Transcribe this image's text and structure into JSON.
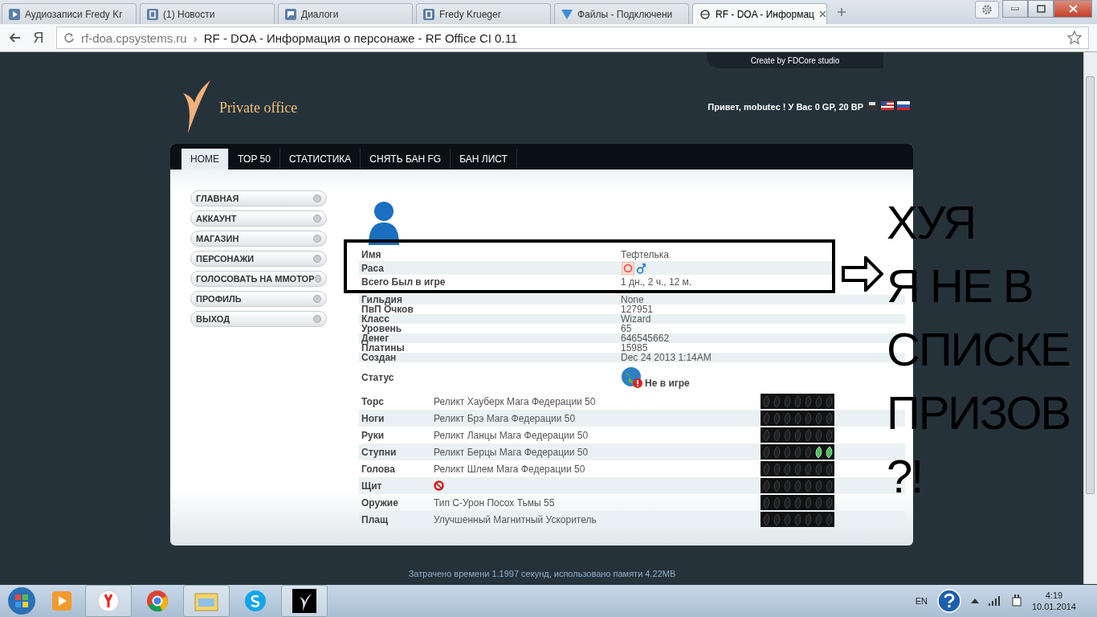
{
  "browser": {
    "tabs": [
      {
        "title": "Аудиозаписи Fredy Kr",
        "selected": false
      },
      {
        "title": "(1) Новости",
        "selected": false
      },
      {
        "title": "Диалоги",
        "selected": false
      },
      {
        "title": "Fredy Krueger",
        "selected": false
      },
      {
        "title": "Файлы - Подключени",
        "selected": false
      },
      {
        "title": "RF - DOA - Информац",
        "selected": true
      }
    ],
    "logo_key": "Я",
    "address": {
      "host": "rf-doa.cpsystems.ru",
      "separator": "›",
      "title": "RF - DOA - Информация о персонаже - RF Office CI 0.11"
    }
  },
  "page": {
    "credit": "Create by FDCore studio",
    "logo_text": "Private office",
    "greeting": "Привет, mobutec ! У Вас 0 GP, 20 BP",
    "nav": [
      {
        "label": "HOME",
        "selected": true
      },
      {
        "label": "TOP 50",
        "selected": false
      },
      {
        "label": "СТАТИСТИКА",
        "selected": false
      },
      {
        "label": "СНЯТЬ БАН FG",
        "selected": false
      },
      {
        "label": "БАН ЛИСТ",
        "selected": false
      }
    ],
    "menu": [
      "ГЛАВНАЯ",
      "АККАУНТ",
      "МАГАЗИН",
      "ПЕРСОНАЖИ",
      "ГОЛОСОВАТЬ НА ММОТОР",
      "ПРОФИЛЬ",
      "ВЫХОД"
    ],
    "info": [
      {
        "label": "Имя",
        "value": "Тефтелька",
        "highlighted": true
      },
      {
        "label": "Раса",
        "kind": "race",
        "highlighted": true
      },
      {
        "label": "Всего Был в игре",
        "value": "1 дн., 2 ч., 12 м.",
        "highlighted": true
      },
      {
        "label": "Гильдия",
        "value": "None",
        "highlighted": false
      },
      {
        "label": "ПвП Очков",
        "value": "127951",
        "highlighted": false
      },
      {
        "label": "Класс",
        "value": "Wizard",
        "highlighted": false
      },
      {
        "label": "Уровень",
        "value": "65",
        "highlighted": false
      },
      {
        "label": "Денег",
        "value": "646545662",
        "highlighted": false
      },
      {
        "label": "Платины",
        "value": "15985",
        "highlighted": false
      },
      {
        "label": "Создан",
        "value": "Dec 24 2013 1:14AM",
        "highlighted": false
      },
      {
        "label": "Статус",
        "kind": "status",
        "value": "Не в игре"
      }
    ],
    "equipment": [
      {
        "slot": "Торс",
        "item": "Реликт Хауберк Мага Федерации 50",
        "upgrade_slots": [
          false,
          false,
          false,
          false,
          false,
          false,
          false
        ]
      },
      {
        "slot": "Ноги",
        "item": "Реликт Брэ Мага Федерации 50",
        "upgrade_slots": [
          false,
          false,
          false,
          false,
          false,
          false,
          false
        ]
      },
      {
        "slot": "Руки",
        "item": "Реликт Ланцы Мага Федерации 50",
        "upgrade_slots": [
          false,
          false,
          false,
          false,
          false,
          false,
          false
        ]
      },
      {
        "slot": "Ступни",
        "item": "Реликт Берцы Мага Федерации 50",
        "upgrade_slots": [
          false,
          false,
          false,
          false,
          false,
          true,
          true
        ]
      },
      {
        "slot": "Голова",
        "item": "Реликт Шлем Мага Федерации 50",
        "upgrade_slots": [
          false,
          false,
          false,
          false,
          false,
          false,
          false
        ]
      },
      {
        "slot": "Щит",
        "kind": "empty",
        "upgrade_slots": [
          false,
          false,
          false,
          false,
          false,
          false,
          false
        ]
      },
      {
        "slot": "Оружие",
        "item": "Тип С-Урон Посох Тьмы 55",
        "upgrade_slots": [
          false,
          false,
          false,
          false,
          false,
          false,
          false
        ]
      },
      {
        "slot": "Плащ",
        "item": "Улучшенный Магнитный Ускоритель",
        "upgrade_slots": [
          false,
          false,
          false,
          false,
          false,
          false,
          false
        ]
      }
    ],
    "footer": "Затрачено времени 1.1997 секунд, использовано памяти 4.22MB",
    "annotation": [
      "ХУЯ",
      "Я НЕ В",
      "СПИСКЕ",
      "ПРИЗОВ",
      "?!"
    ]
  },
  "taskbar": {
    "language": "EN",
    "time": "4:19",
    "date": "10.01.2014"
  }
}
